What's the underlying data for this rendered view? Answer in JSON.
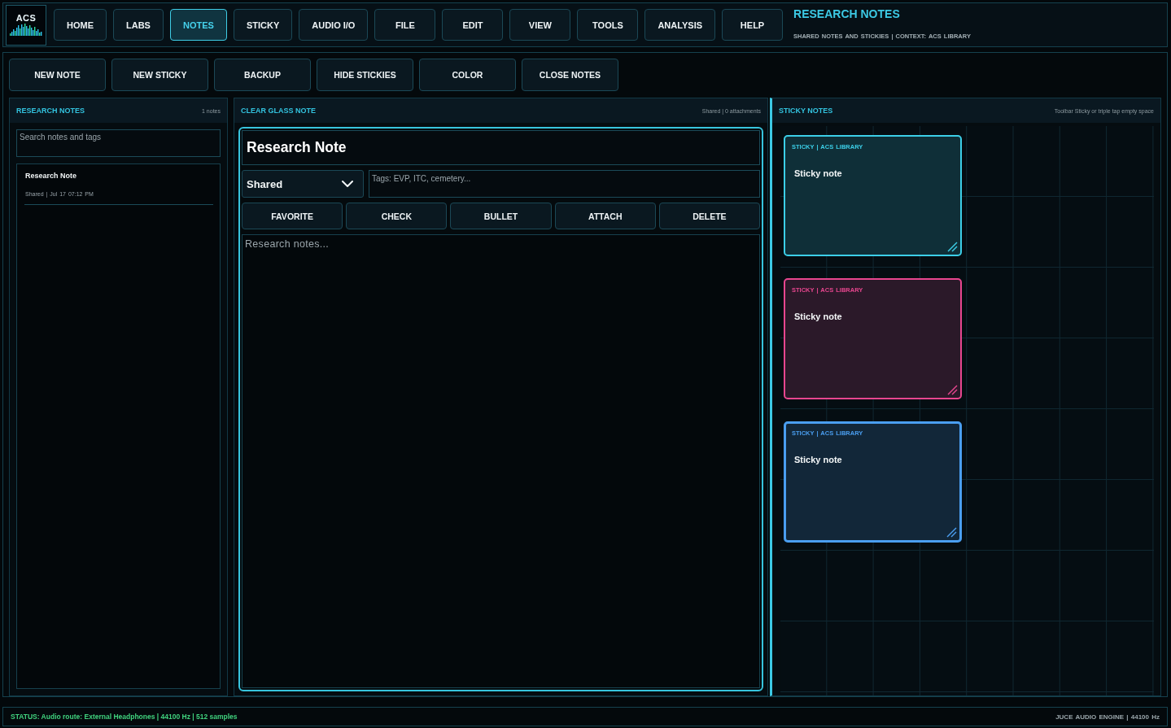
{
  "logo": {
    "text": "ACS"
  },
  "nav": [
    {
      "label": "HOME",
      "selected": false
    },
    {
      "label": "LABS",
      "selected": false
    },
    {
      "label": "NOTES",
      "selected": true
    },
    {
      "label": "STICKY",
      "selected": false
    },
    {
      "label": "AUDIO I/O",
      "selected": false
    },
    {
      "label": "FILE",
      "selected": false
    },
    {
      "label": "EDIT",
      "selected": false
    },
    {
      "label": "VIEW",
      "selected": false
    },
    {
      "label": "TOOLS",
      "selected": false
    },
    {
      "label": "ANALYSIS",
      "selected": false
    },
    {
      "label": "HELP",
      "selected": false
    }
  ],
  "header": {
    "title": "RESEARCH NOTES",
    "subtitle": "SHARED NOTES AND STICKIES | CONTEXT: ACS LIBRARY"
  },
  "toolbar": [
    "NEW NOTE",
    "NEW STICKY",
    "BACKUP",
    "HIDE STICKIES",
    "COLOR",
    "CLOSE NOTES"
  ],
  "notes_panel": {
    "title": "RESEARCH NOTES",
    "count": "1 notes",
    "search": {
      "placeholder": "Search notes and tags"
    },
    "notes": [
      {
        "title": "Research Note",
        "meta": "Shared | Jul 17 07:12 PM"
      }
    ]
  },
  "editor_panel": {
    "title": "CLEAR GLASS NOTE",
    "info": "Shared | 0 attachments",
    "note_title": "Research Note",
    "visibility": "Shared",
    "tags": {
      "placeholder": "Tags: EVP, ITC, cemetery..."
    },
    "actions": [
      "FAVORITE",
      "CHECK",
      "BULLET",
      "ATTACH",
      "DELETE"
    ],
    "body": {
      "placeholder": "Research notes..."
    }
  },
  "sticky_panel": {
    "title": "STICKY NOTES",
    "hint": "Toolbar Sticky or triple tap empty space",
    "stickies": [
      {
        "header": "STICKY | ACS LIBRARY",
        "text": "Sticky note",
        "color": "#3ccfe8",
        "selected": false
      },
      {
        "header": "STICKY | ACS LIBRARY",
        "text": "Sticky note",
        "color": "#e8468f",
        "selected": false
      },
      {
        "header": "STICKY | ACS LIBRARY",
        "text": "Sticky note",
        "color": "#4a9ef0",
        "selected": true
      }
    ]
  },
  "status_bar": {
    "status": "STATUS: Audio route: External Headphones | 44100 Hz | 512 samples",
    "engine": "JUCE AUDIO ENGINE | 44100 Hz"
  }
}
